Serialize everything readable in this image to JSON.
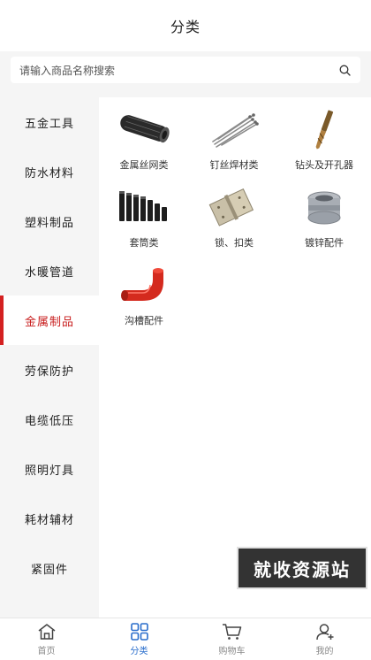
{
  "header": {
    "title": "分类"
  },
  "search": {
    "placeholder": "请输入商品名称搜索",
    "icon": "search-icon"
  },
  "sidebar": {
    "active_index": 4,
    "items": [
      {
        "label": "五金工具"
      },
      {
        "label": "防水材料"
      },
      {
        "label": "塑料制品"
      },
      {
        "label": "水暖管道"
      },
      {
        "label": "金属制品"
      },
      {
        "label": "劳保防护"
      },
      {
        "label": "电缆低压"
      },
      {
        "label": "照明灯具"
      },
      {
        "label": "耗材辅材"
      },
      {
        "label": "紧固件"
      }
    ]
  },
  "categories": [
    {
      "label": "金属丝网类",
      "icon": "wire-mesh-roll-image"
    },
    {
      "label": "钉丝焊材类",
      "icon": "welding-rods-image"
    },
    {
      "label": "钻头及开孔器",
      "icon": "drill-bit-image"
    },
    {
      "label": "套筒类",
      "icon": "sleeves-image"
    },
    {
      "label": "锁、扣类",
      "icon": "hinges-image"
    },
    {
      "label": "镀锌配件",
      "icon": "galvanized-fitting-image"
    },
    {
      "label": "沟槽配件",
      "icon": "grooved-elbow-image"
    }
  ],
  "watermark": {
    "text": "就收资源站"
  },
  "tabbar": {
    "active_index": 1,
    "tabs": [
      {
        "label": "首页",
        "icon": "home-icon"
      },
      {
        "label": "分类",
        "icon": "category-grid-icon"
      },
      {
        "label": "购物车",
        "icon": "cart-icon"
      },
      {
        "label": "我的",
        "icon": "user-icon"
      }
    ]
  },
  "colors": {
    "accent_red": "#c81e1e",
    "tab_active_blue": "#2a6ecc",
    "page_bg": "#f5f5f5"
  }
}
